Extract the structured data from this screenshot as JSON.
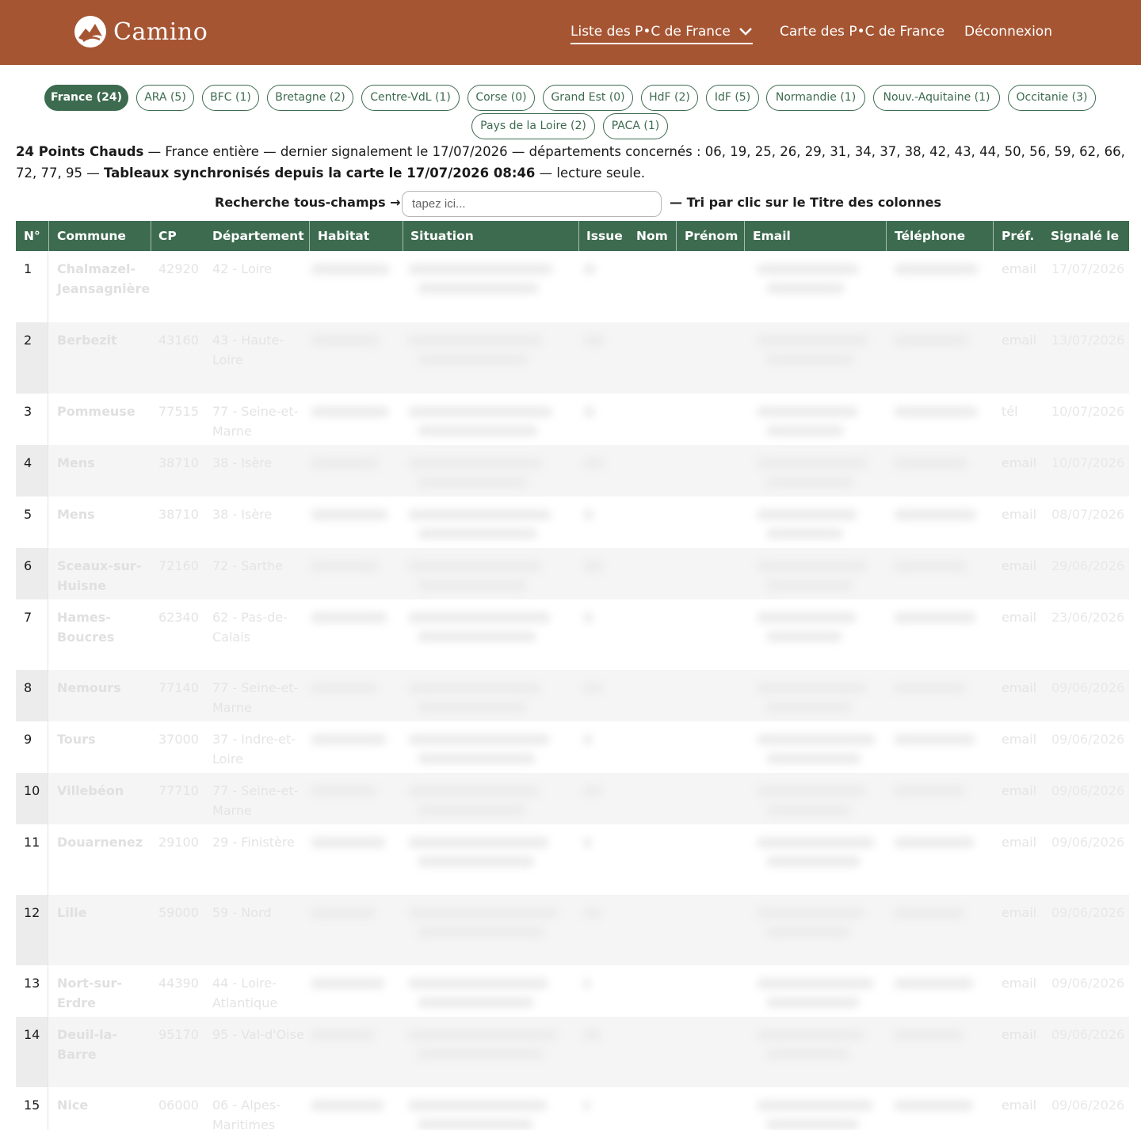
{
  "brand": {
    "name": "Camino",
    "logo_icon": "mountain-logo-icon"
  },
  "nav": {
    "list_label": "Liste des P•C de France",
    "map_label": "Carte des P•C de France",
    "logout_label": "Déconnexion"
  },
  "colors": {
    "header": "#a65533",
    "accent": "#3d6b4f"
  },
  "regions": [
    {
      "label": "France (24)",
      "active": true
    },
    {
      "label": "ARA (5)"
    },
    {
      "label": "BFC (1)"
    },
    {
      "label": "Bretagne (2)"
    },
    {
      "label": "Centre-VdL (1)"
    },
    {
      "label": "Corse (0)"
    },
    {
      "label": "Grand Est (0)"
    },
    {
      "label": "HdF (2)"
    },
    {
      "label": "IdF (5)"
    },
    {
      "label": "Normandie (1)"
    },
    {
      "label": "Nouv.-Aquitaine (1)"
    },
    {
      "label": "Occitanie (3)"
    },
    {
      "label": "Pays de la Loire (2)"
    },
    {
      "label": "PACA (1)"
    }
  ],
  "summary": {
    "count": "24 Points Chauds",
    "details": " — France entière — dernier signalement le 17/07/2026 — départements concernés : 06, 19, 25, 26, 29, 31, 34, 37, 38, 42, 43, 44, 50, 56, 59, 62, 66, 72, 77, 95 — ",
    "sync": "Tableaux synchronisés depuis la carte le 17/07/2026 08:46",
    "readonly": " — lecture seule."
  },
  "search": {
    "label": "Recherche tous-champs →",
    "placeholder": "tapez ici...",
    "sort_note": "— Tri par clic sur le Titre des colonnes"
  },
  "table": {
    "headers": [
      "N°",
      "Commune",
      "CP",
      "Département",
      "Habitat",
      "Situation",
      "Issue",
      "Nom",
      "Prénom",
      "Email",
      "Téléphone",
      "Préf.",
      "Signalé le"
    ],
    "rows": [
      {
        "num": "1",
        "commune": "Chalmazel-Jeansagnière",
        "cp": "42920",
        "dept": "42 - Loire",
        "pref": "email",
        "date": "17/07/2026"
      },
      {
        "num": "2",
        "commune": "Berbezit",
        "cp": "43160",
        "dept": "43 - Haute-Loire",
        "pref": "email",
        "date": "13/07/2026"
      },
      {
        "num": "3",
        "commune": "Pommeuse",
        "cp": "77515",
        "dept": "77 - Seine-et-Marne",
        "pref": "tél",
        "date": "10/07/2026"
      },
      {
        "num": "4",
        "commune": "Mens",
        "cp": "38710",
        "dept": "38 - Isère",
        "pref": "email",
        "date": "10/07/2026"
      },
      {
        "num": "5",
        "commune": "Mens",
        "cp": "38710",
        "dept": "38 - Isère",
        "pref": "email",
        "date": "08/07/2026"
      },
      {
        "num": "6",
        "commune": "Sceaux-sur-Huisne",
        "cp": "72160",
        "dept": "72 - Sarthe",
        "pref": "email",
        "date": "29/06/2026"
      },
      {
        "num": "7",
        "commune": "Hames-Boucres",
        "cp": "62340",
        "dept": "62 - Pas-de-Calais",
        "pref": "email",
        "date": "23/06/2026"
      },
      {
        "num": "8",
        "commune": "Nemours",
        "cp": "77140",
        "dept": "77 - Seine-et-Marne",
        "pref": "email",
        "date": "09/06/2026"
      },
      {
        "num": "9",
        "commune": "Tours",
        "cp": "37000",
        "dept": "37 - Indre-et-Loire",
        "pref": "email",
        "date": "09/06/2026"
      },
      {
        "num": "10",
        "commune": "Villebéon",
        "cp": "77710",
        "dept": "77 - Seine-et-Marne",
        "pref": "email",
        "date": "09/06/2026"
      },
      {
        "num": "11",
        "commune": "Douarnenez",
        "cp": "29100",
        "dept": "29 - Finistère",
        "pref": "email",
        "date": "09/06/2026"
      },
      {
        "num": "12",
        "commune": "Lille",
        "cp": "59000",
        "dept": "59 - Nord",
        "pref": "email",
        "date": "09/06/2026"
      },
      {
        "num": "13",
        "commune": "Nort-sur-Erdre",
        "cp": "44390",
        "dept": "44 - Loire-Atlantique",
        "pref": "email",
        "date": "09/06/2026"
      },
      {
        "num": "14",
        "commune": "Deuil-la-Barre",
        "cp": "95170",
        "dept": "95 - Val-d'Oise",
        "pref": "email",
        "date": "09/06/2026"
      },
      {
        "num": "15",
        "commune": "Nice",
        "cp": "06000",
        "dept": "06 - Alpes-Maritimes",
        "pref": "email",
        "date": "09/06/2026"
      }
    ]
  }
}
